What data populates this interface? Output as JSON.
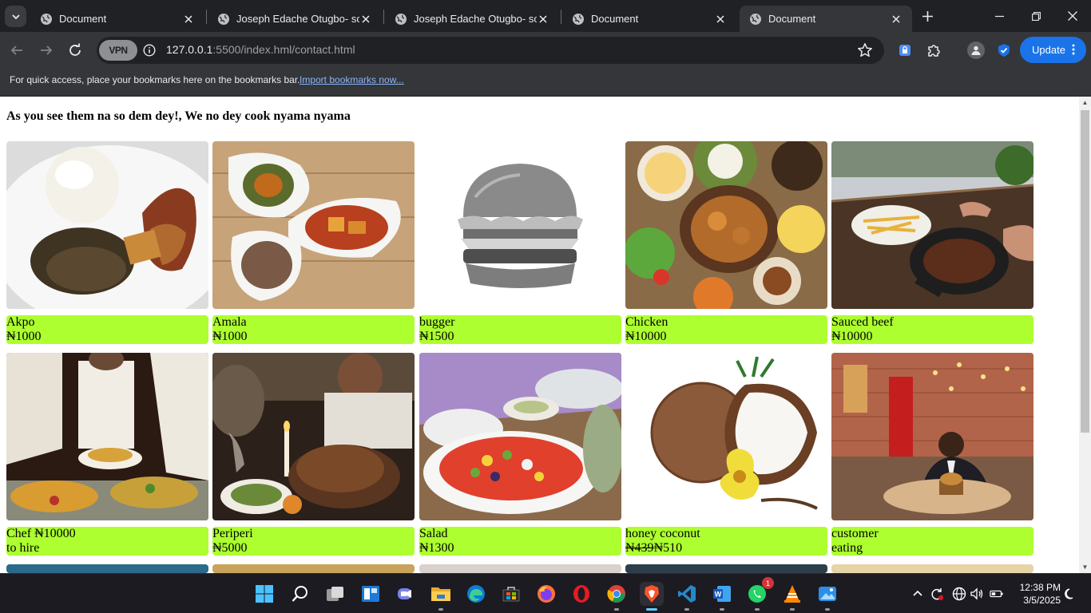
{
  "browser": {
    "tabs": [
      {
        "title": "Document",
        "active": false
      },
      {
        "title": "Joseph Edache Otugbo- soft",
        "active": false
      },
      {
        "title": "Joseph Edache Otugbo- soft",
        "active": false
      },
      {
        "title": "Document",
        "active": false
      },
      {
        "title": "Document",
        "active": true
      }
    ],
    "vpn_label": "VPN",
    "url_host": "127.0.0.1",
    "url_path": ":5500/index.hml/contact.html",
    "update_label": "Update",
    "bookmarks_hint": "For quick access, place your bookmarks here on the bookmarks bar.",
    "bookmarks_link": "Import bookmarks now..."
  },
  "page": {
    "heading": "As you see them na so dem dey!, We no dey cook nyama nyama",
    "items": [
      {
        "name": "Akpo",
        "price": "₦1000",
        "image": "pounded-yam-plate"
      },
      {
        "name": "Amala",
        "price": "₦1000",
        "image": "soups-bowls"
      },
      {
        "name": "bugger",
        "price": "₦1500",
        "image": "burger-bw"
      },
      {
        "name": "Chicken",
        "price": "₦10000",
        "image": "platter"
      },
      {
        "name": "Sauced beef",
        "price": "₦10000",
        "image": "steak-pan"
      },
      {
        "name": "Chef ₦10000",
        "price": "to hire",
        "image": "chefs-serving"
      },
      {
        "name": "Periperi",
        "price": "₦5000",
        "image": "roast-dinner"
      },
      {
        "name": "Salad",
        "price": "₦1300",
        "image": "fruit-salad"
      },
      {
        "name": "honey coconut",
        "price_old": "₦439",
        "price": "₦510",
        "image": "coconut-flower"
      },
      {
        "name": "customer",
        "price": "eating",
        "image": "restaurant-customer"
      }
    ]
  },
  "taskbar": {
    "apps": [
      "windows-start-icon",
      "search-icon",
      "task-view-icon",
      "widgets-icon",
      "teams-icon",
      "file-explorer-icon",
      "edge-icon",
      "store-icon",
      "firefox-icon",
      "opera-icon",
      "chrome-icon",
      "brave-icon",
      "vscode-icon",
      "word-icon",
      "whatsapp-icon",
      "vlc-icon",
      "photos-icon"
    ],
    "whatsapp_badge": "1",
    "time": "12:38 PM",
    "date": "3/5/2025"
  },
  "colors": {
    "label_bg": "#adff2f",
    "update_blue": "#1a73e8",
    "link_blue": "#8ab4f8"
  }
}
